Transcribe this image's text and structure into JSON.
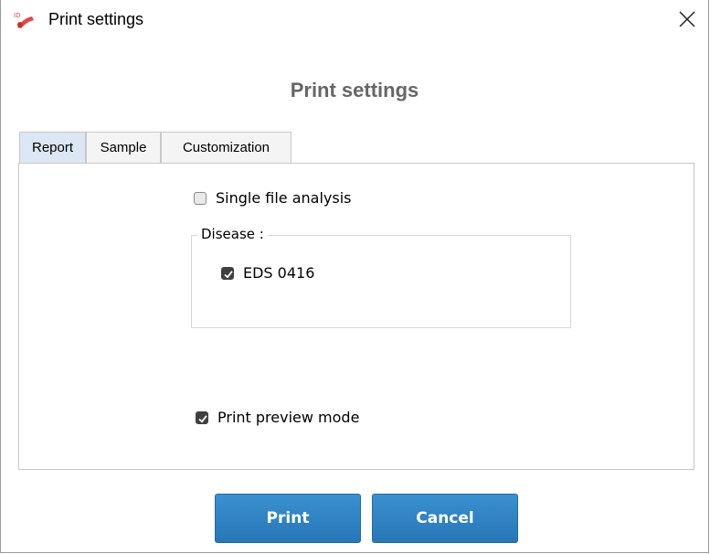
{
  "window": {
    "title": "Print settings",
    "app_icon": "idgen-logo-icon",
    "close_icon": "close-icon"
  },
  "dialog": {
    "heading": "Print settings"
  },
  "tabs": [
    {
      "label": "Report",
      "active": true
    },
    {
      "label": "Sample",
      "active": false
    },
    {
      "label": "Customization",
      "active": false
    }
  ],
  "report": {
    "single_file_analysis": {
      "label": "Single file analysis",
      "checked": false
    },
    "disease_group": {
      "legend": "Disease :",
      "items": [
        {
          "label": "EDS 0416",
          "checked": true
        }
      ]
    },
    "print_preview": {
      "label": "Print preview mode",
      "checked": true
    }
  },
  "buttons": {
    "print": "Print",
    "cancel": "Cancel"
  },
  "colors": {
    "button_blue": "#2d82c4",
    "active_tab": "#dbe7f5",
    "heading_gray": "#666666"
  }
}
